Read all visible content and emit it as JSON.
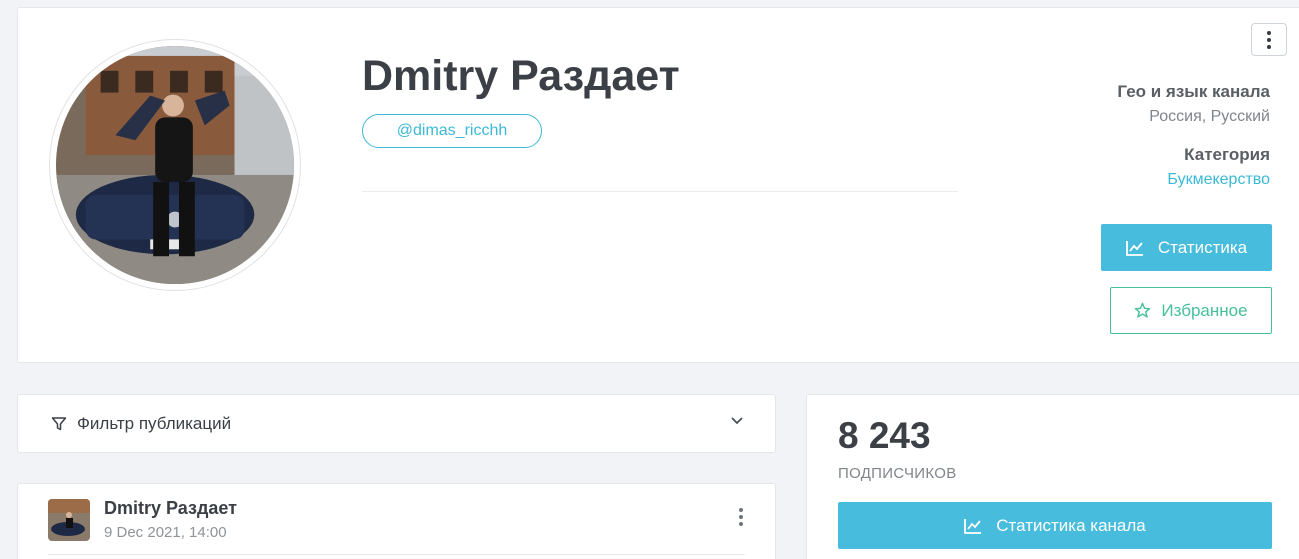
{
  "channel": {
    "title": "Dmitry Раздает",
    "username": "@dimas_ricchh"
  },
  "meta": {
    "geo_label": "Гео и язык канала",
    "geo_value": "Россия, Русский",
    "category_label": "Категория",
    "category_value": "Букмекерство"
  },
  "buttons": {
    "stats": "Статистика",
    "favorite": "Избранное",
    "channel_stats": "Статистика канала"
  },
  "filter": {
    "label": "Фильтр публикаций"
  },
  "post": {
    "author": "Dmitry Раздает",
    "date": "9 Dec 2021, 14:00"
  },
  "subscribers": {
    "count": "8 243",
    "label": "ПОДПИСЧИКОВ"
  },
  "colors": {
    "accent": "#48bcdc",
    "favorite": "#45c09a",
    "background": "#f2f3f7"
  },
  "icons": [
    "more-vertical-icon",
    "chart-line-icon",
    "star-icon",
    "filter-icon",
    "chevron-down-icon"
  ]
}
